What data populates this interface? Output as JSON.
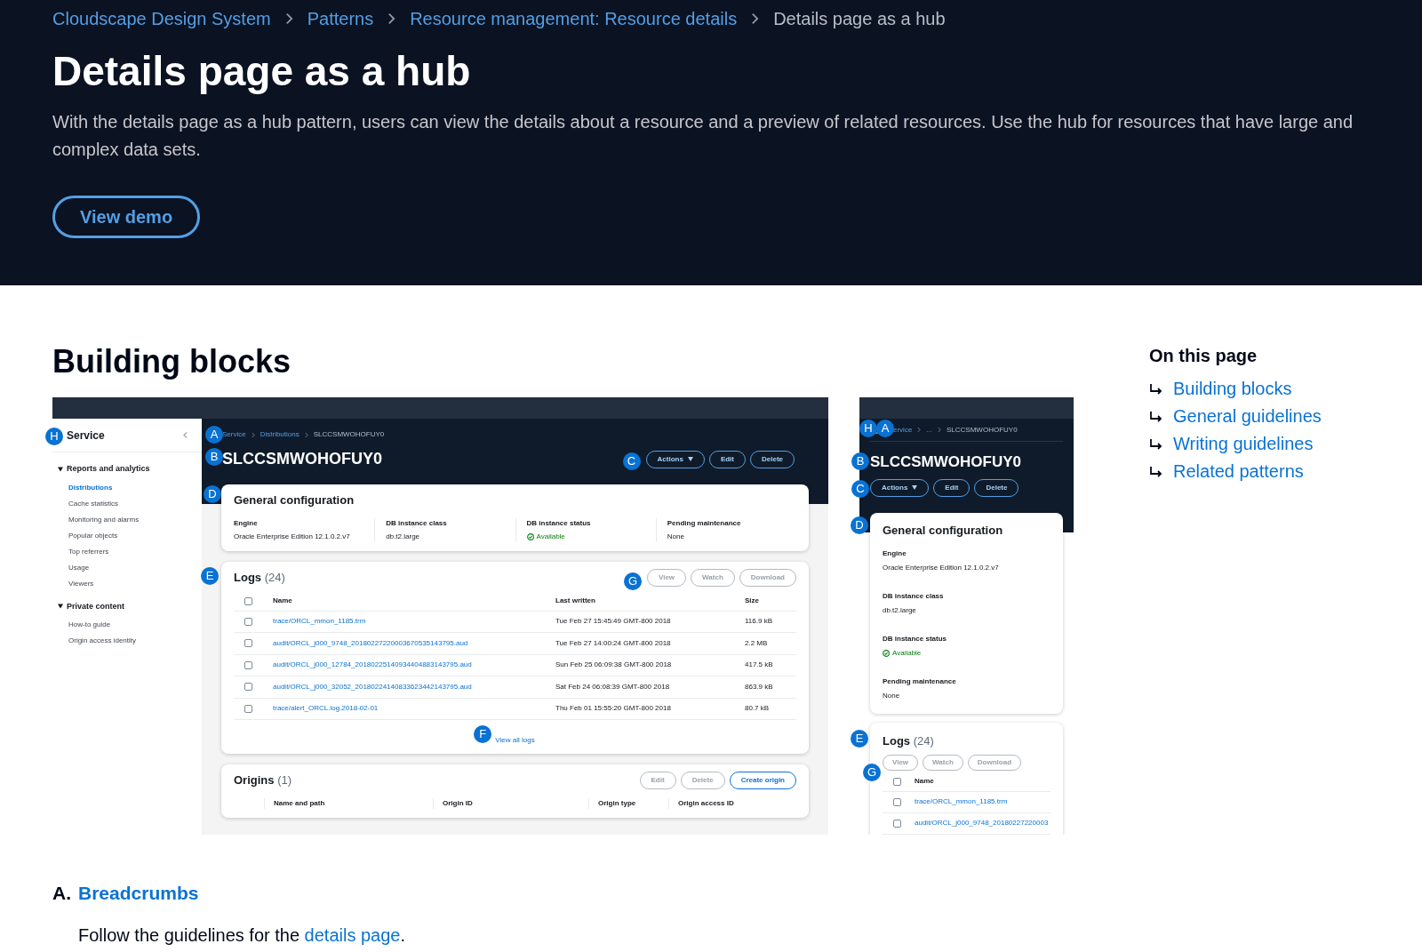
{
  "breadcrumbs": [
    {
      "label": "Cloudscape Design System",
      "current": false
    },
    {
      "label": "Patterns",
      "current": false
    },
    {
      "label": "Resource management: Resource details",
      "current": false
    },
    {
      "label": "Details page as a hub",
      "current": true
    }
  ],
  "title": "Details page as a hub",
  "description": "With the details page as a hub pattern, users can view the details about a resource and a preview of related resources. Use the hub for resources that have large and complex data sets.",
  "demo_button": "View demo",
  "section_title": "Building blocks",
  "desktop_mockup": {
    "sidebar": {
      "title": "Service",
      "marker": "H",
      "groups": [
        {
          "label": "Reports and analytics",
          "expanded": true,
          "items": [
            {
              "label": "Distributions",
              "selected": true
            },
            {
              "label": "Cache statistics",
              "selected": false
            },
            {
              "label": "Monitoring and alarms",
              "selected": false
            },
            {
              "label": "Popular objects",
              "selected": false
            },
            {
              "label": "Top referrers",
              "selected": false
            },
            {
              "label": "Usage",
              "selected": false
            },
            {
              "label": "Viewers",
              "selected": false
            }
          ]
        },
        {
          "label": "Private content",
          "expanded": true,
          "items": [
            {
              "label": "How-to guide",
              "selected": false
            },
            {
              "label": "Origin access identity",
              "selected": false
            }
          ]
        }
      ]
    },
    "breadcrumbs": {
      "marker": "A",
      "items": [
        {
          "label": "Service",
          "current": false
        },
        {
          "label": "Distributions",
          "current": false
        },
        {
          "label": "SLCCSMWOHOFUY0",
          "current": true
        }
      ]
    },
    "resource_title": {
      "marker": "B",
      "text": "SLCCSMWOHOFUY0"
    },
    "header_buttons": {
      "marker": "C",
      "items": [
        {
          "label": "Actions",
          "kind": "dropdown"
        },
        {
          "label": "Edit",
          "kind": "plain"
        },
        {
          "label": "Delete",
          "kind": "plain"
        }
      ]
    },
    "general": {
      "marker": "D",
      "title": "General configuration",
      "fields": [
        {
          "label": "Engine",
          "value": "Oracle Enterprise Edition 12.1.0.2.v7",
          "kind": "text"
        },
        {
          "label": "DB instance class",
          "value": "db.t2.large",
          "kind": "text"
        },
        {
          "label": "DB instance status",
          "value": "Available",
          "kind": "status"
        },
        {
          "label": "Pending maintenance",
          "value": "None",
          "kind": "text"
        }
      ]
    },
    "logs": {
      "marker": "E",
      "title": "Logs",
      "count": "(24)",
      "buttons_marker": "G",
      "buttons": [
        {
          "label": "View",
          "disabled": true
        },
        {
          "label": "Watch",
          "disabled": true
        },
        {
          "label": "Download",
          "disabled": true
        }
      ],
      "columns": [
        "Name",
        "Last written",
        "Size"
      ],
      "all_checked": false,
      "rows": [
        {
          "checked": false,
          "cells": [
            "trace/ORCL_mmon_1185.trm",
            "Tue Feb 27 15:45:49 GMT-800 2018",
            "116.9 kB"
          ]
        },
        {
          "checked": false,
          "cells": [
            "audit/ORCL_j000_9748_20180227220003670535143795.aud",
            "Tue Feb 27 14:00:24 GMT-800 2018",
            "2.2 MB"
          ]
        },
        {
          "checked": false,
          "cells": [
            "audit/ORCL_j000_12784_20180225140934404883143795.aud",
            "Sun Feb 25 06:09:38 GMT-800 2018",
            "417.5 kB"
          ]
        },
        {
          "checked": false,
          "cells": [
            "audit/ORCL_j000_32052_20180224140833623442143795.aud",
            "Sat Feb 24 06:08:39 GMT-800 2018",
            "863.9 kB"
          ]
        },
        {
          "checked": false,
          "cells": [
            "trace/alert_ORCL.log.2018-02-01",
            "Thu Feb 01 15:55:20 GMT-800 2018",
            "80.7 kB"
          ]
        }
      ],
      "footer_marker": "F",
      "footer_link": "View all logs"
    },
    "origins": {
      "title": "Origins",
      "count": "(1)",
      "buttons": [
        {
          "label": "Edit",
          "disabled": true
        },
        {
          "label": "Delete",
          "disabled": true
        },
        {
          "label": "Create origin",
          "disabled": false
        }
      ],
      "columns": [
        "Name and path",
        "Origin ID",
        "Origin type",
        "Origin access ID"
      ]
    }
  },
  "mobile_mockup": {
    "menu_marker": "H",
    "breadcrumbs": {
      "marker": "A",
      "items": [
        {
          "label": "ervice",
          "current": false
        },
        {
          "label": "...",
          "current": false
        },
        {
          "label": "SLCCSMWOHOFUY0",
          "current": true
        }
      ]
    },
    "resource_title": {
      "marker": "B",
      "text": "SLCCSMWOHOFUY0"
    },
    "header_buttons": {
      "marker": "C",
      "items": [
        {
          "label": "Actions",
          "kind": "dropdown"
        },
        {
          "label": "Edit",
          "kind": "plain"
        },
        {
          "label": "Delete",
          "kind": "plain"
        }
      ]
    },
    "general": {
      "marker": "D",
      "title": "General configuration",
      "fields": [
        {
          "label": "Engine",
          "value": "Oracle Enterprise Edition 12.1.0.2.v7",
          "kind": "text"
        },
        {
          "label": "DB instance class",
          "value": "db.t2.large",
          "kind": "text"
        },
        {
          "label": "DB instance status",
          "value": "Available",
          "kind": "status"
        },
        {
          "label": "Pending maintenance",
          "value": "None",
          "kind": "text"
        }
      ]
    },
    "logs": {
      "marker": "E",
      "title": "Logs",
      "count": "(24)",
      "buttons_marker": "G",
      "buttons": [
        {
          "label": "View",
          "disabled": true
        },
        {
          "label": "Watch",
          "disabled": true
        },
        {
          "label": "Download",
          "disabled": true
        }
      ],
      "columns": [
        "Name"
      ],
      "all_checked": false,
      "rows": [
        {
          "checked": false,
          "cells": [
            "trace/ORCL_mmon_1185.trm"
          ]
        },
        {
          "checked": false,
          "cells": [
            "audit/ORCL_j000_9748_20180227220003"
          ]
        }
      ]
    }
  },
  "toc": {
    "title": "On this page",
    "items": [
      "Building blocks",
      "General guidelines",
      "Writing guidelines",
      "Related patterns"
    ]
  },
  "subsection": {
    "letter": "A.",
    "title": "Breadcrumbs",
    "text_before": "Follow the guidelines for the ",
    "link": "details page",
    "text_after": "."
  }
}
